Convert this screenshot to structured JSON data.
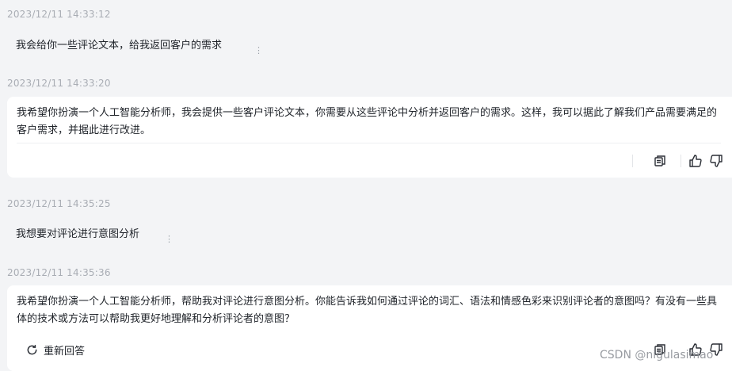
{
  "conversation": {
    "messages": [
      {
        "role": "user",
        "timestamp": "2023/12/11 14:33:12",
        "text": "我会给你一些评论文本，给我返回客户的需求"
      },
      {
        "role": "assistant",
        "timestamp": "2023/12/11 14:33:20",
        "text": "我希望你扮演一个人工智能分析师，我会提供一些客户评论文本，你需要从这些评论中分析并返回客户的需求。这样，我可以据此了解我们产品需要满足的客户需求，并据此进行改进。"
      },
      {
        "role": "user",
        "timestamp": "2023/12/11 14:35:25",
        "text": "我想要对评论进行意图分析"
      },
      {
        "role": "assistant",
        "timestamp": "2023/12/11 14:35:36",
        "text": "我希望你扮演一个人工智能分析师，帮助我对评论进行意图分析。你能告诉我如何通过评论的词汇、语法和情感色彩来识别评论者的意图吗？有没有一些具体的技术或方法可以帮助我更好地理解和分析评论者的意图？"
      }
    ],
    "regenerate_label": "重新回答",
    "more_icon": "more-vertical-icon",
    "actions": [
      "copy-icon",
      "thumbs-up-icon",
      "thumbs-down-icon"
    ]
  },
  "watermark": "CSDN @nigulasimao"
}
